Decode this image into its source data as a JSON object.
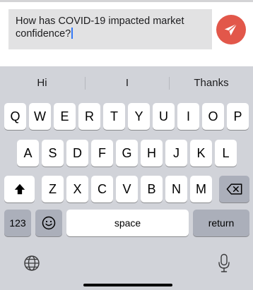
{
  "composer": {
    "message_text": "How has COVID-19 impacted market confidence?",
    "send_color": "#e2574a"
  },
  "keyboard": {
    "suggestions": [
      "Hi",
      "I",
      "Thanks"
    ],
    "row1": [
      "Q",
      "W",
      "E",
      "R",
      "T",
      "Y",
      "U",
      "I",
      "O",
      "P"
    ],
    "row2": [
      "A",
      "S",
      "D",
      "F",
      "G",
      "H",
      "J",
      "K",
      "L"
    ],
    "row3": [
      "Z",
      "X",
      "C",
      "V",
      "B",
      "N",
      "M"
    ],
    "numbers_label": "123",
    "space_label": "space",
    "return_label": "return",
    "icons": {
      "shift": "shift-arrow-icon",
      "delete": "backspace-icon",
      "emoji": "emoji-icon",
      "globe": "globe-icon",
      "mic": "microphone-icon",
      "send": "paper-plane-icon"
    }
  }
}
